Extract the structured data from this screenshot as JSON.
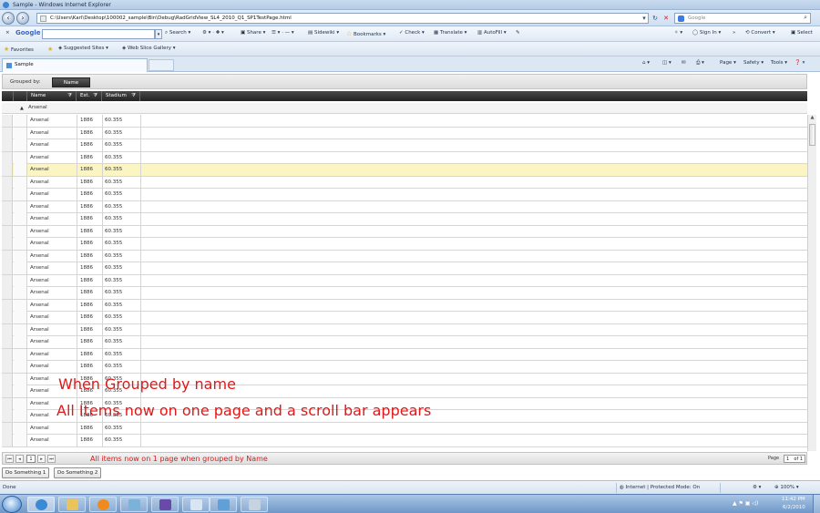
{
  "window": {
    "title": "Sample - Windows Internet Explorer",
    "url": "C:\\Users\\Karl\\Desktop\\100002_sample\\Bin\\Debug\\RadGridView_SL4_2010_Q1_SP1TestPage.html",
    "search_placeholder": "Google"
  },
  "google_toolbar": {
    "close": "×",
    "logo": "Google",
    "search": "Search",
    "share": "Share",
    "sidewiki": "Sidewiki",
    "bookmarks": "Bookmarks",
    "check": "Check",
    "translate": "Translate",
    "autofill": "AutoFill",
    "sign_in": "Sign In",
    "convert": "Convert",
    "select": "Select"
  },
  "favorites_bar": {
    "favorites": "Favorites",
    "suggested_sites": "Suggested Sites",
    "web_slice_gallery": "Web Slice Gallery"
  },
  "tab": {
    "title": "Sample"
  },
  "command_bar": {
    "page": "Page",
    "safety": "Safety",
    "tools": "Tools"
  },
  "grid": {
    "grouped_by_label": "Grouped by:",
    "group_chip": "Name",
    "columns": [
      "Name",
      "Est.",
      "Stadium"
    ],
    "group_name": "Arsenal",
    "rows": [
      {
        "name": "Arsenal",
        "est": "1886",
        "stadium": "60.355"
      },
      {
        "name": "Arsenal",
        "est": "1886",
        "stadium": "60.355"
      },
      {
        "name": "Arsenal",
        "est": "1886",
        "stadium": "60.355"
      },
      {
        "name": "Arsenal",
        "est": "1886",
        "stadium": "60.355"
      },
      {
        "name": "Arsenal",
        "est": "1886",
        "stadium": "60.355"
      },
      {
        "name": "Arsenal",
        "est": "1886",
        "stadium": "60.355"
      },
      {
        "name": "Arsenal",
        "est": "1886",
        "stadium": "60.355"
      },
      {
        "name": "Arsenal",
        "est": "1886",
        "stadium": "60.355"
      },
      {
        "name": "Arsenal",
        "est": "1886",
        "stadium": "60.355"
      },
      {
        "name": "Arsenal",
        "est": "1886",
        "stadium": "60.355"
      },
      {
        "name": "Arsenal",
        "est": "1886",
        "stadium": "60.355"
      },
      {
        "name": "Arsenal",
        "est": "1886",
        "stadium": "60.355"
      },
      {
        "name": "Arsenal",
        "est": "1886",
        "stadium": "60.355"
      },
      {
        "name": "Arsenal",
        "est": "1886",
        "stadium": "60.355"
      },
      {
        "name": "Arsenal",
        "est": "1886",
        "stadium": "60.355"
      },
      {
        "name": "Arsenal",
        "est": "1886",
        "stadium": "60.355"
      },
      {
        "name": "Arsenal",
        "est": "1886",
        "stadium": "60.355"
      },
      {
        "name": "Arsenal",
        "est": "1886",
        "stadium": "60.355"
      },
      {
        "name": "Arsenal",
        "est": "1886",
        "stadium": "60.355"
      },
      {
        "name": "Arsenal",
        "est": "1886",
        "stadium": "60.355"
      },
      {
        "name": "Arsenal",
        "est": "1886",
        "stadium": "60.355"
      },
      {
        "name": "Arsenal",
        "est": "1886",
        "stadium": "60.355"
      },
      {
        "name": "Arsenal",
        "est": "1886",
        "stadium": "60.355"
      },
      {
        "name": "Arsenal",
        "est": "1886",
        "stadium": "60.355"
      },
      {
        "name": "Arsenal",
        "est": "1886",
        "stadium": "60.355"
      },
      {
        "name": "Arsenal",
        "est": "1886",
        "stadium": "60.355"
      },
      {
        "name": "Arsenal",
        "est": "1886",
        "stadium": "60.355"
      }
    ],
    "selected_row_index": 4
  },
  "pager": {
    "current_page": "1",
    "note": "All items now on 1 page when grouped by Name",
    "page_label": "Page",
    "page_input": "1",
    "of_label": "of 1"
  },
  "buttons": {
    "do_something_1": "Do Something 1",
    "do_something_2": "Do Something 2"
  },
  "annotations": {
    "line1": "When Grouped by name",
    "line2": "All Items now on one page and a scroll bar appears"
  },
  "status_bar": {
    "status": "Done",
    "zone": "Internet | Protected Mode: On",
    "zoom": "100%"
  },
  "taskbar": {
    "time": "11:42 PM",
    "date": "6/2/2010"
  },
  "colors": {
    "annotation_red": "#e01818",
    "selected_row": "#fbf5c4",
    "header_dark": "#2a2a2a"
  }
}
